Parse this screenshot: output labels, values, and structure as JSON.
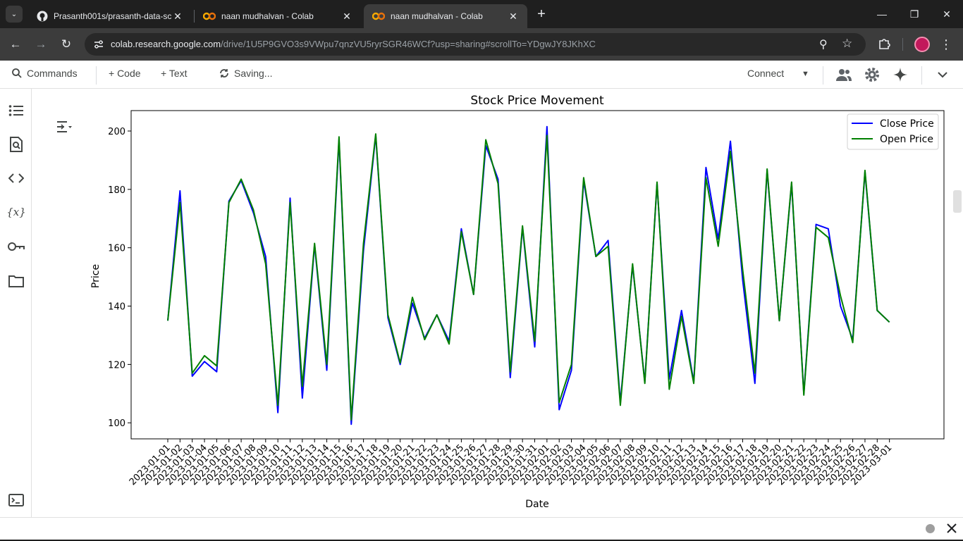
{
  "browser": {
    "tab_menu_glyph": "⌄",
    "tabs": [
      {
        "title": "Prasanth001s/prasanth-data-sci",
        "icon": "github-icon",
        "close": "✕"
      },
      {
        "title": "naan mudhalvan - Colab",
        "icon": "colab-icon",
        "close": "✕"
      },
      {
        "title": "naan mudhalvan - Colab",
        "icon": "colab-icon",
        "close": "✕",
        "active": true
      }
    ],
    "new_tab_glyph": "+",
    "window": {
      "minimize": "—",
      "restore": "❐",
      "close": "✕"
    },
    "nav": {
      "back": "←",
      "forward": "→",
      "reload": "↻"
    },
    "url_host": "colab.research.google.com",
    "url_path": "/drive/1U5P9GVO3s9VWpu7qnzVU5ryrSGR46WCf?usp=sharing#scrollTo=YDgwJY8JKhXC",
    "zoom_glyph": "⚲",
    "star_glyph": "☆",
    "menu_glyph": "⋮"
  },
  "colab": {
    "commands": "Commands",
    "code": "+ Code",
    "text": "+ Text",
    "saving": "Saving...",
    "connect": "Connect",
    "dropdown_glyph": "▼",
    "collapse_glyph": "⌄"
  },
  "sidebar": {
    "toc_glyph": "☰",
    "variables_glyph": "{𝑥}",
    "code_glyph": "<>"
  },
  "colors": {
    "close_series": "#0000ff",
    "open_series": "#008000"
  },
  "chart_data": {
    "type": "line",
    "title": "Stock Price Movement",
    "xlabel": "Date",
    "ylabel": "Price",
    "ylim": [
      94.5,
      207
    ],
    "yticks": [
      100,
      120,
      140,
      160,
      180,
      200
    ],
    "grid": false,
    "legend": "top-right",
    "x": [
      "2023-01-01",
      "2023-01-02",
      "2023-01-03",
      "2023-01-04",
      "2023-01-05",
      "2023-01-06",
      "2023-01-07",
      "2023-01-08",
      "2023-01-09",
      "2023-01-10",
      "2023-01-11",
      "2023-01-12",
      "2023-01-13",
      "2023-01-14",
      "2023-01-15",
      "2023-01-16",
      "2023-01-17",
      "2023-01-18",
      "2023-01-19",
      "2023-01-20",
      "2023-01-21",
      "2023-01-22",
      "2023-01-23",
      "2023-01-24",
      "2023-01-25",
      "2023-01-26",
      "2023-01-27",
      "2023-01-28",
      "2023-01-29",
      "2023-01-30",
      "2023-01-31",
      "2023-02-01",
      "2023-02-02",
      "2023-02-03",
      "2023-02-04",
      "2023-02-05",
      "2023-02-06",
      "2023-02-07",
      "2023-02-08",
      "2023-02-09",
      "2023-02-10",
      "2023-02-11",
      "2023-02-12",
      "2023-02-13",
      "2023-02-14",
      "2023-02-15",
      "2023-02-16",
      "2023-02-17",
      "2023-02-18",
      "2023-02-19",
      "2023-02-20",
      "2023-02-21",
      "2023-02-22",
      "2023-02-23",
      "2023-02-24",
      "2023-02-25",
      "2023-02-26",
      "2023-02-27",
      "2023-02-28",
      "2023-03-01"
    ],
    "series": [
      {
        "name": "Close Price",
        "values": [
          135,
          179.5,
          116,
          121,
          117.5,
          176,
          183,
          172,
          157,
          103.5,
          177,
          108.5,
          161,
          118,
          197,
          99.5,
          159,
          198.5,
          136,
          120,
          141,
          129,
          137,
          128,
          166.5,
          144,
          195,
          183.5,
          115.5,
          167,
          126,
          201.5,
          104.5,
          118,
          183,
          157,
          162.5,
          107,
          154,
          114,
          182,
          115,
          138.5,
          114,
          187.5,
          163,
          196.5,
          149,
          113.5,
          186.5,
          135,
          182,
          110,
          168,
          166.5,
          140,
          128.5,
          186,
          138.5,
          134.5
        ]
      },
      {
        "name": "Open Price",
        "values": [
          135,
          175.5,
          117,
          123,
          119.5,
          175.5,
          183.5,
          173,
          154.5,
          106,
          175.5,
          112.5,
          161.5,
          120,
          198,
          101,
          161.5,
          199,
          137,
          120.5,
          143,
          128.5,
          137,
          127,
          165.5,
          144,
          197,
          182,
          117.5,
          167.5,
          128,
          198.5,
          107,
          120,
          184,
          157,
          160.5,
          106,
          154.5,
          113.5,
          182.5,
          111.5,
          136.5,
          113.5,
          184,
          160.5,
          193,
          152.5,
          117,
          187,
          135,
          182.5,
          109.5,
          167,
          163.5,
          143.5,
          127.5,
          186.5,
          138.5,
          134.5
        ]
      }
    ]
  }
}
